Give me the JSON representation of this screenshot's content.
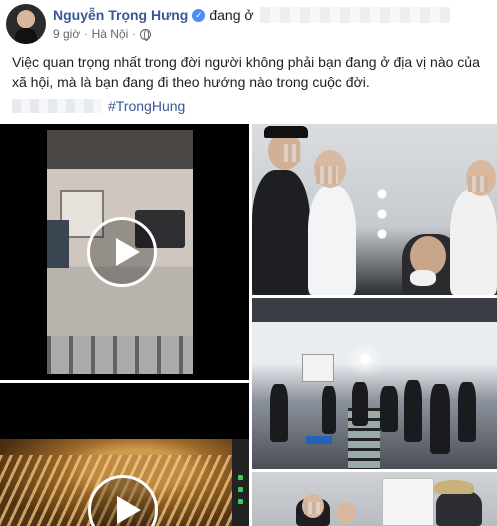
{
  "post": {
    "author": {
      "name": "Nguyễn Trọng Hưng",
      "verified_icon": "verified-badge-icon",
      "status": "đang ở"
    },
    "time": "9 giờ",
    "separator": "·",
    "location": "Hà Nội",
    "privacy_icon": "globe-icon",
    "text": "Việc quan trọng nhất trong đời người không phải bạn đang ở địa vị nào của xã hội, mà là bạn đang đi theo hướng nào trong cuộc đời.",
    "hashtag": "#TrongHung"
  },
  "media": {
    "items": [
      {
        "type": "video",
        "name": "video-set-truck"
      },
      {
        "type": "video",
        "name": "video-noodles"
      },
      {
        "type": "photo",
        "name": "photo-crew-lights"
      },
      {
        "type": "photo",
        "name": "photo-studio-rail"
      },
      {
        "type": "photo",
        "name": "photo-crew-board"
      }
    ]
  },
  "colors": {
    "link": "#385898",
    "text": "#1c1e21",
    "meta": "#606770",
    "verified": "#4c8ef7"
  }
}
